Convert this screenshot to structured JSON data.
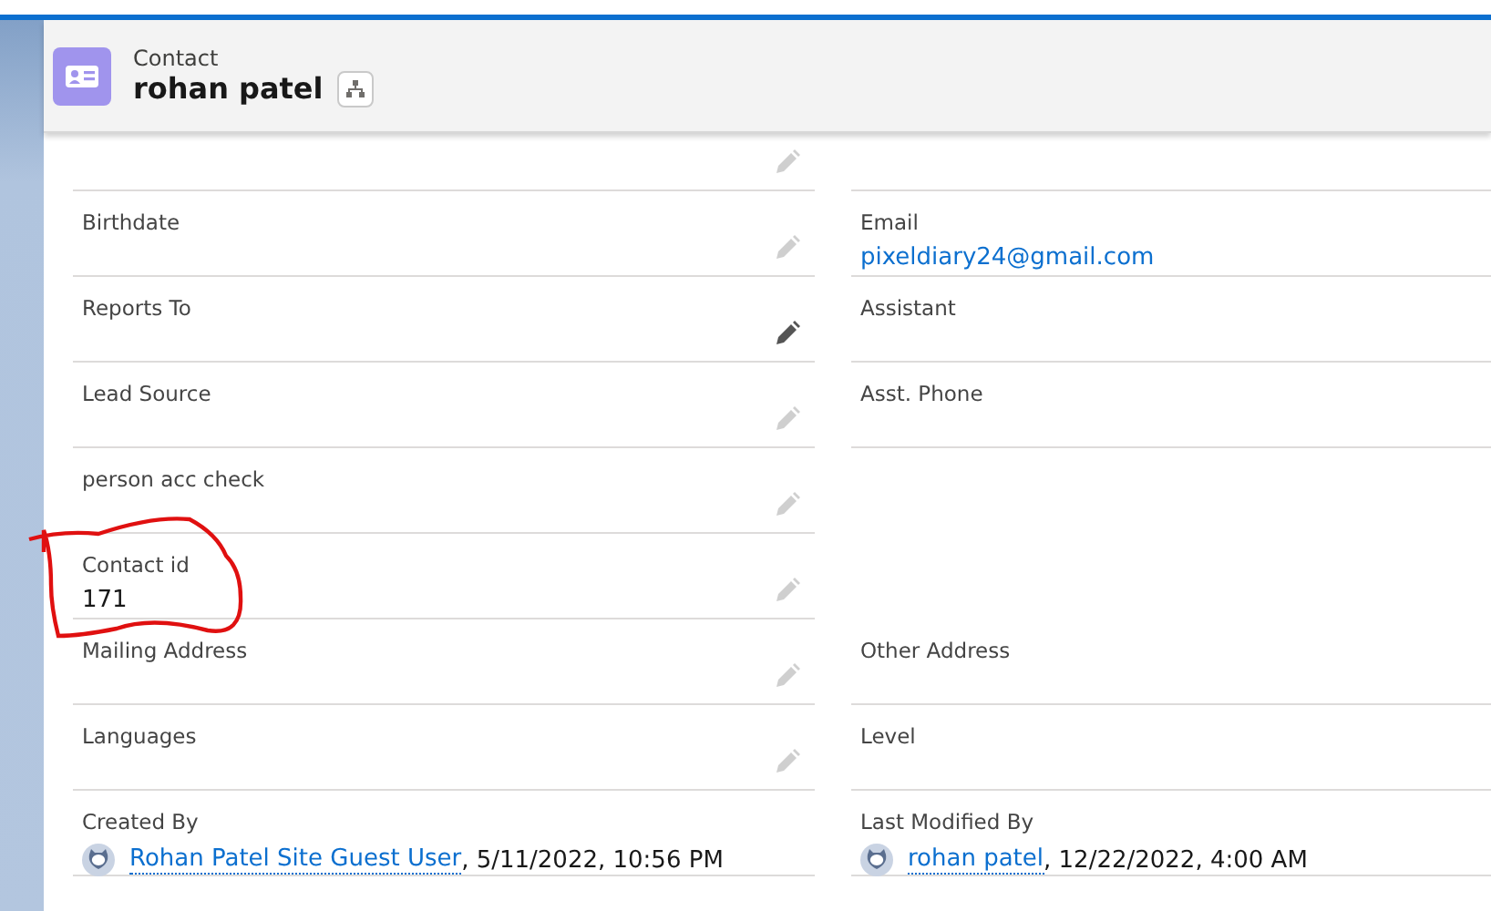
{
  "header": {
    "object_type": "Contact",
    "record_name": "rohan patel"
  },
  "fields": [
    {
      "kind": "field",
      "editable": true,
      "edit_hover": false
    },
    {
      "kind": "field"
    },
    {
      "kind": "field",
      "label": "Birthdate",
      "editable": true,
      "edit_hover": false
    },
    {
      "kind": "field",
      "label": "Email",
      "email": "pixeldiary24@gmail.com"
    },
    {
      "kind": "field",
      "label": "Reports To",
      "editable": true,
      "edit_hover": true
    },
    {
      "kind": "field",
      "label": "Assistant"
    },
    {
      "kind": "field",
      "label": "Lead Source",
      "editable": true,
      "edit_hover": false
    },
    {
      "kind": "field",
      "label": "Asst. Phone"
    },
    {
      "kind": "field",
      "label": "person acc check",
      "editable": true,
      "edit_hover": false
    },
    {
      "kind": "empty"
    },
    {
      "kind": "field",
      "label": "Contact id",
      "value": "171",
      "editable": true,
      "edit_hover": false,
      "annotated": true
    },
    {
      "kind": "empty"
    },
    {
      "kind": "field",
      "label": "Mailing Address",
      "editable": true,
      "edit_hover": false
    },
    {
      "kind": "field",
      "label": "Other Address"
    },
    {
      "kind": "field",
      "label": "Languages",
      "editable": true,
      "edit_hover": false
    },
    {
      "kind": "field",
      "label": "Level"
    },
    {
      "kind": "field",
      "label": "Created By",
      "user": "Rohan Patel Site Guest User",
      "timestamp": ", 5/11/2022, 10:56 PM"
    },
    {
      "kind": "field",
      "label": "Last Modified By",
      "user": "rohan patel",
      "timestamp": ", 12/22/2022, 4:00 AM"
    }
  ]
}
